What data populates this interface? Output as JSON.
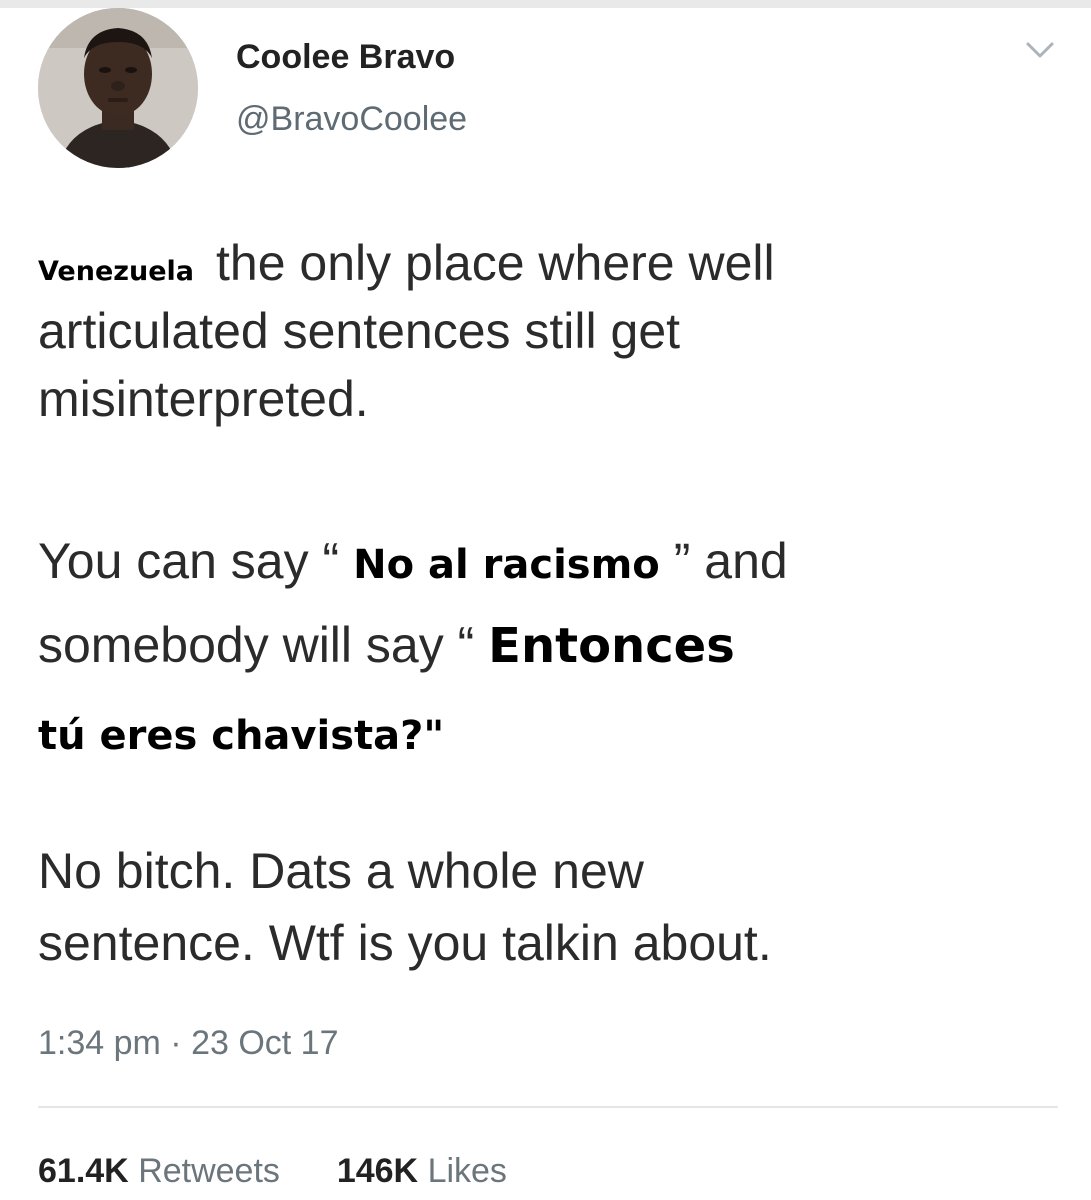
{
  "author": {
    "display_name": "Coolee Bravo",
    "handle": "@BravoCoolee"
  },
  "tweet": {
    "line1_overlay": "Venezuela",
    "line1": "the only place where well",
    "line2": "articulated sentences still get",
    "line3": "misinterpreted.",
    "line4_before": "You can say “",
    "line4_overlay": "No al racismo",
    "line4_after": "” and",
    "line5_before": "somebody will say “",
    "line5_overlay": "Entonces",
    "line6_overlay": "tú eres chavista?\"",
    "line7": "No bitch. Dats a whole new",
    "line8": "sentence. Wtf is you talkin about."
  },
  "meta": {
    "timestamp": "1:34 pm · 23 Oct 17"
  },
  "stats": {
    "retweets_count": "61.4K",
    "retweets_label": "Retweets",
    "likes_count": "146K",
    "likes_label": "Likes"
  },
  "icons": {
    "menu": "chevron-down-icon",
    "avatar": "avatar"
  }
}
